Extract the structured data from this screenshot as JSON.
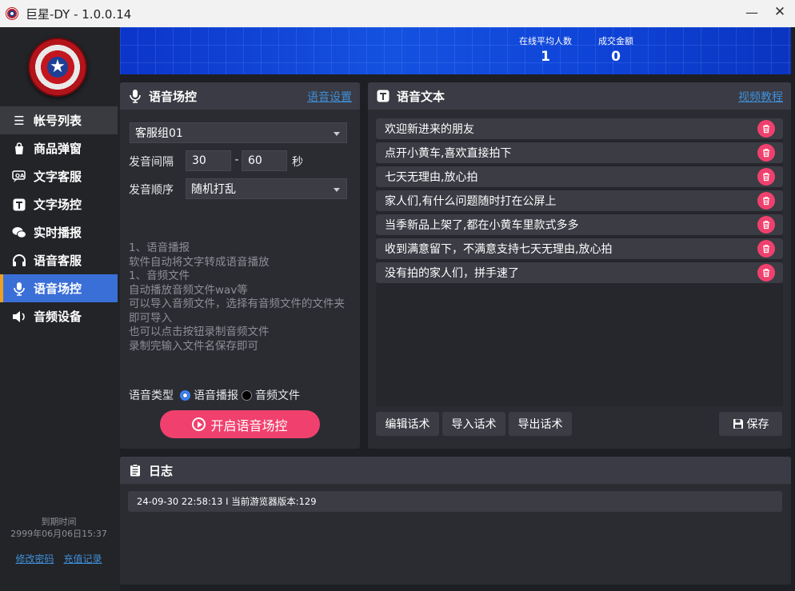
{
  "window": {
    "title": "巨星-DY - 1.0.0.14",
    "minimize": "—",
    "close": "✕"
  },
  "sidebar": {
    "items": [
      {
        "label": "帐号列表",
        "icon": "list-icon"
      },
      {
        "label": "商品弹窗",
        "icon": "shopping-bag-icon"
      },
      {
        "label": "文字客服",
        "icon": "qa-chat-icon"
      },
      {
        "label": "文字场控",
        "icon": "text-t-icon"
      },
      {
        "label": "实时播报",
        "icon": "wechat-bubble-icon"
      },
      {
        "label": "语音客服",
        "icon": "headset-icon"
      },
      {
        "label": "语音场控",
        "icon": "microphone-icon"
      },
      {
        "label": "音频设备",
        "icon": "speaker-icon"
      }
    ],
    "active_index": 6,
    "expire_label": "到期时间",
    "expire_value": "2999年06月06日15:37",
    "change_password": "修改密码",
    "recharge_record": "充值记录"
  },
  "banner": {
    "online_label": "在线平均人数",
    "online_value": "1",
    "amount_label": "成交金额",
    "amount_value": "0"
  },
  "voice_control": {
    "title": "语音场控",
    "settings_link": "语音设置",
    "group_value": "客服组01",
    "interval_label": "发音间隔",
    "interval_min": "30",
    "interval_sep": "-",
    "interval_max": "60",
    "interval_unit": "秒",
    "order_label": "发音顺序",
    "order_value": "随机打乱",
    "description": [
      "1、语音播报",
      "软件自动将文字转成语音播放",
      "1、音频文件",
      "自动播放音频文件wav等",
      "可以导入音频文件，选择有音频文件的文件夹即可导入",
      "也可以点击按钮录制音频文件",
      "录制完输入文件名保存即可"
    ],
    "type_label": "语音类型",
    "type_option_tts": "语音播报",
    "type_option_file": "音频文件",
    "start_button": "开启语音场控"
  },
  "voice_text": {
    "title": "语音文本",
    "tutorial_link": "视频教程",
    "items": [
      "欢迎新进来的朋友",
      "点开小黄车,喜欢直接拍下",
      "七天无理由,放心拍",
      "家人们,有什么问题随时打在公屏上",
      "当季新品上架了,都在小黄车里款式多多",
      "收到满意留下，不满意支持七天无理由,放心拍",
      "没有拍的家人们，拼手速了"
    ],
    "edit_button": "编辑话术",
    "import_button": "导入话术",
    "export_button": "导出话术",
    "save_button": "保存"
  },
  "log": {
    "title": "日志",
    "lines": [
      "24-09-30 22:58:13 I  当前游览器版本:129"
    ]
  }
}
